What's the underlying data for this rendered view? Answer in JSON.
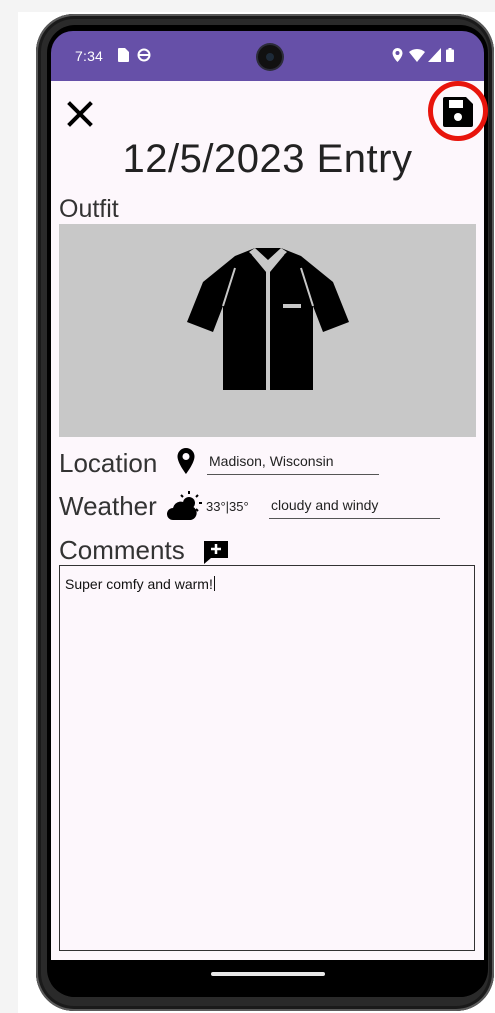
{
  "status_bar": {
    "time": "7:34",
    "background": "#6650a8",
    "left_icons": [
      "sim-card-icon",
      "sync-icon"
    ],
    "right_icons": [
      "location-icon",
      "wifi-icon",
      "signal-icon",
      "battery-icon"
    ]
  },
  "toolbar": {
    "close_icon": "close-icon",
    "save_icon": "save-icon",
    "save_highlight_color": "#e8140c"
  },
  "entry": {
    "title": "12/5/2023 Entry"
  },
  "outfit": {
    "label": "Outfit",
    "image_icon": "shirt-icon",
    "image_background": "#c8c8c8"
  },
  "location": {
    "label": "Location",
    "icon": "map-pin-icon",
    "value": "Madison, Wisconsin"
  },
  "weather": {
    "label": "Weather",
    "icon": "partly-cloudy-icon",
    "temperature": "33°|35°",
    "value": "cloudy and windy"
  },
  "comments": {
    "label": "Comments",
    "icon": "add-comment-icon",
    "value": "Super comfy and warm!"
  },
  "nav_bar": {
    "handle": "home-handle"
  }
}
